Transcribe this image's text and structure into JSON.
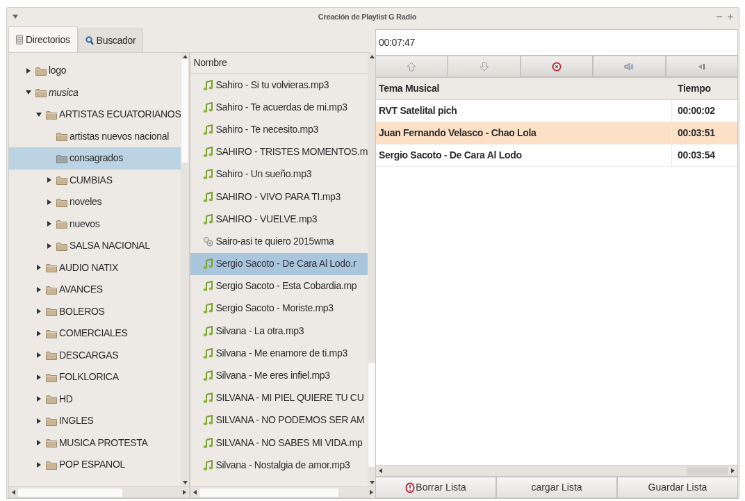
{
  "window": {
    "title": "Creación de Playlist G Radio"
  },
  "tabs": [
    {
      "label": "Directorios",
      "selected": true,
      "kind": "folders"
    },
    {
      "label": "Buscador",
      "selected": false,
      "kind": "search"
    }
  ],
  "tree": {
    "items": [
      {
        "label": "logo",
        "kind": "branch",
        "expanded": false,
        "emphasized": false,
        "selected": false
      },
      {
        "label": "musica",
        "kind": "branch",
        "expanded": true,
        "emphasized": true,
        "selected": false,
        "children": [
          {
            "label": "ARTISTAS ECUATORIANOS",
            "kind": "branch",
            "expanded": true,
            "emphasized": false,
            "selected": false,
            "children": [
              {
                "label": "artistas nuevos nacional",
                "kind": "leaf",
                "emphasized": false,
                "selected": false
              },
              {
                "label": "consagrados",
                "kind": "leaf",
                "emphasized": false,
                "selected": true
              },
              {
                "label": "CUMBIAS",
                "kind": "branch",
                "expanded": false,
                "emphasized": false,
                "selected": false
              },
              {
                "label": "noveles",
                "kind": "branch",
                "expanded": false,
                "emphasized": false,
                "selected": false
              },
              {
                "label": "nuevos",
                "kind": "branch",
                "expanded": false,
                "emphasized": false,
                "selected": false
              },
              {
                "label": "SALSA NACIONAL",
                "kind": "branch",
                "expanded": false,
                "emphasized": false,
                "selected": false
              }
            ]
          },
          {
            "label": "AUDIO NATIX",
            "kind": "branch",
            "expanded": false,
            "emphasized": false,
            "selected": false
          },
          {
            "label": "AVANCES",
            "kind": "branch",
            "expanded": false,
            "emphasized": false,
            "selected": false
          },
          {
            "label": "BOLEROS",
            "kind": "branch",
            "expanded": false,
            "emphasized": false,
            "selected": false
          },
          {
            "label": "COMERCIALES",
            "kind": "branch",
            "expanded": false,
            "emphasized": false,
            "selected": false
          },
          {
            "label": "DESCARGAS",
            "kind": "branch",
            "expanded": false,
            "emphasized": false,
            "selected": false
          },
          {
            "label": "FOLKLORICA",
            "kind": "branch",
            "expanded": false,
            "emphasized": false,
            "selected": false
          },
          {
            "label": "HD",
            "kind": "branch",
            "expanded": false,
            "emphasized": false,
            "selected": false
          },
          {
            "label": "INGLES",
            "kind": "branch",
            "expanded": false,
            "emphasized": false,
            "selected": false
          },
          {
            "label": "MUSICA PROTESTA",
            "kind": "branch",
            "expanded": false,
            "emphasized": false,
            "selected": false
          },
          {
            "label": "POP ESPANOL",
            "kind": "branch",
            "expanded": false,
            "emphasized": false,
            "selected": false
          }
        ]
      }
    ]
  },
  "files": {
    "column": "Nombre",
    "rows": [
      {
        "name": "Sahiro - Si tu volvieras.mp3",
        "kind": "audio",
        "selected": false
      },
      {
        "name": "Sahiro - Te acuerdas de mi.mp3",
        "kind": "audio",
        "selected": false
      },
      {
        "name": "Sahiro - Te necesito.mp3",
        "kind": "audio",
        "selected": false
      },
      {
        "name": "SAHIRO - TRISTES MOMENTOS.m",
        "kind": "audio",
        "selected": false
      },
      {
        "name": "Sahiro - Un sueño.mp3",
        "kind": "audio",
        "selected": false
      },
      {
        "name": "SAHIRO - VIVO PARA TI.mp3",
        "kind": "audio",
        "selected": false
      },
      {
        "name": "SAHIRO - VUELVE.mp3",
        "kind": "audio",
        "selected": false
      },
      {
        "name": "Sairo-asi te quiero 2015wma",
        "kind": "other",
        "selected": false
      },
      {
        "name": "Sergio Sacoto - De Cara Al Lodo.r",
        "kind": "audio",
        "selected": true
      },
      {
        "name": "Sergio Sacoto - Esta Cobardia.mp",
        "kind": "audio",
        "selected": false
      },
      {
        "name": "Sergio Sacoto - Moriste.mp3",
        "kind": "audio",
        "selected": false
      },
      {
        "name": "Silvana - La otra.mp3",
        "kind": "audio",
        "selected": false
      },
      {
        "name": "Silvana - Me enamore de ti.mp3",
        "kind": "audio",
        "selected": false
      },
      {
        "name": "Silvana  - Me eres infiel.mp3",
        "kind": "audio",
        "selected": false
      },
      {
        "name": "SILVANA - MI PIEL QUIERE TU CU",
        "kind": "audio",
        "selected": false
      },
      {
        "name": "SILVANA - NO PODEMOS SER AM",
        "kind": "audio",
        "selected": false
      },
      {
        "name": "SILVANA - NO SABES MI VIDA.mp",
        "kind": "audio",
        "selected": false
      },
      {
        "name": "Silvana  - Nostalgia de amor.mp3",
        "kind": "audio",
        "selected": false
      }
    ]
  },
  "elapsed": "00:07:47",
  "toolbar": [
    {
      "kind": "up",
      "disabled": true
    },
    {
      "kind": "down",
      "disabled": true
    },
    {
      "kind": "remove",
      "disabled": false
    },
    {
      "kind": "volume",
      "disabled": false
    },
    {
      "kind": "previous",
      "disabled": false
    }
  ],
  "playlist": {
    "columns": [
      "Tema Musical",
      "Tiempo"
    ],
    "rows": [
      {
        "title": "RVT Satelital pich",
        "time": "00:00:02",
        "playing": false
      },
      {
        "title": "Juan Fernando Velasco - Chao Lola",
        "time": "00:03:51",
        "playing": true
      },
      {
        "title": "Sergio Sacoto - De Cara Al Lodo",
        "time": "00:03:54",
        "playing": false
      }
    ]
  },
  "buttons": [
    {
      "label": "Borrar Lista",
      "kind": "warning"
    },
    {
      "label": "cargar Lista",
      "kind": "plain"
    },
    {
      "label": "Guardar Lista",
      "kind": "plain"
    }
  ]
}
